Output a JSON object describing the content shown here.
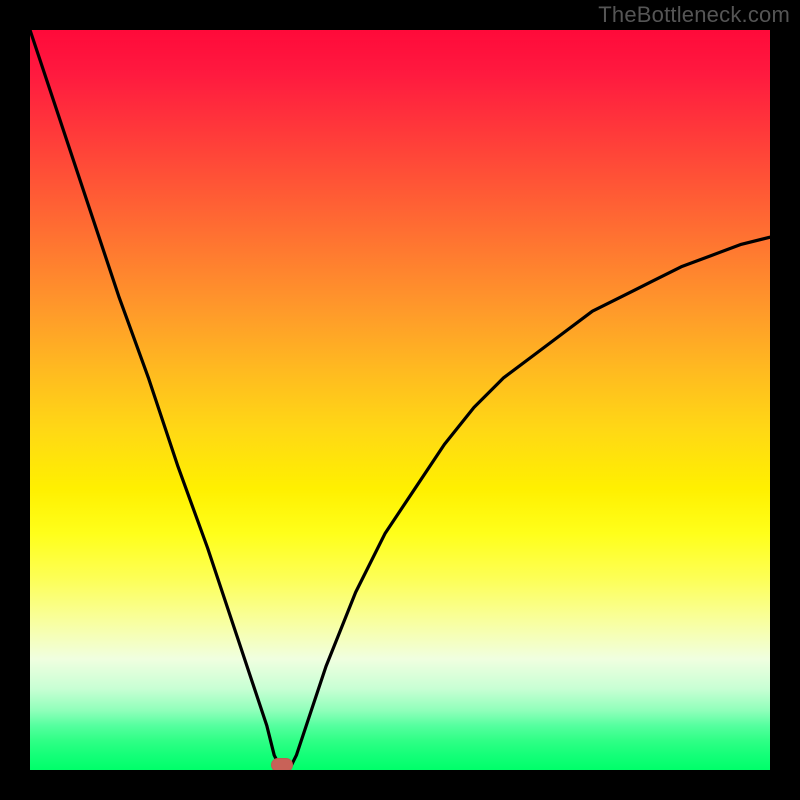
{
  "watermark": "TheBottleneck.com",
  "marker": {
    "x_pct": 34,
    "y_pct": 100
  },
  "colors": {
    "curve_stroke": "#000000",
    "gradient_top": "#ff0a3a",
    "gradient_bottom": "#00ff6a",
    "marker_fill": "#c86258"
  },
  "chart_data": {
    "type": "line",
    "title": "",
    "xlabel": "",
    "ylabel": "",
    "xlim": [
      0,
      100
    ],
    "ylim": [
      0,
      100
    ],
    "series": [
      {
        "name": "bottleneck-curve",
        "x": [
          0,
          4,
          8,
          12,
          16,
          20,
          24,
          28,
          30,
          32,
          33,
          34,
          35,
          36,
          38,
          40,
          44,
          48,
          52,
          56,
          60,
          64,
          68,
          72,
          76,
          80,
          84,
          88,
          92,
          96,
          100
        ],
        "y": [
          100,
          88,
          76,
          64,
          53,
          41,
          30,
          18,
          12,
          6,
          2,
          0,
          0,
          2,
          8,
          14,
          24,
          32,
          38,
          44,
          49,
          53,
          56,
          59,
          62,
          64,
          66,
          68,
          69.5,
          71,
          72
        ]
      }
    ],
    "annotations": [
      {
        "name": "optimal-point",
        "x": 34,
        "y": 0
      }
    ]
  }
}
